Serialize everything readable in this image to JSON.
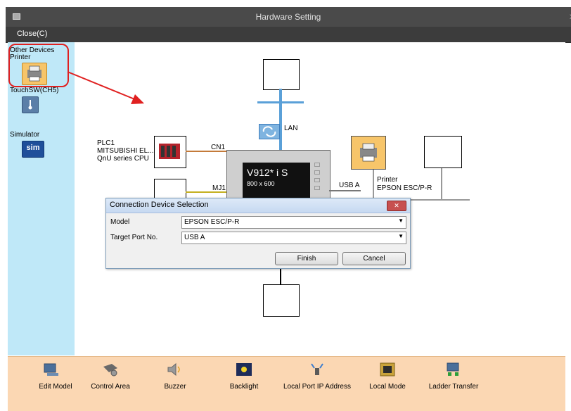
{
  "window": {
    "title": "Hardware Setting",
    "close_symbol": "x"
  },
  "menu": {
    "close_label": "Close(C)"
  },
  "sidebar": {
    "other_devices_label": "Other Devices",
    "printer_label": "Printer",
    "touchsw_label": "TouchSW(CH5)",
    "simulator_label": "Simulator",
    "sim_icon_text": "sim"
  },
  "diagram": {
    "lan_label": "LAN",
    "cn1_label": "CN1",
    "mj1_label": "MJ1",
    "usba_label": "USB A",
    "plc": {
      "line1": "PLC1",
      "line2": "MITSUBISHI EL...",
      "line3": "QnU series CPU"
    },
    "printer": {
      "line1": "Printer",
      "line2": "EPSON ESC/P-R"
    },
    "panel": {
      "model": "V912* i S",
      "resolution": "800 x 600"
    }
  },
  "dialog": {
    "title": "Connection Device Selection",
    "model_label": "Model",
    "model_value": "EPSON ESC/P-R",
    "port_label": "Target Port No.",
    "port_value": "USB A",
    "finish_label": "Finish",
    "cancel_label": "Cancel"
  },
  "toolbar": {
    "items": [
      {
        "label": "Edit Model",
        "icon": "edit-model-icon"
      },
      {
        "label": "Control Area",
        "icon": "control-area-icon"
      },
      {
        "label": "Buzzer",
        "icon": "buzzer-icon"
      },
      {
        "label": "Backlight",
        "icon": "backlight-icon"
      },
      {
        "label": "Local Port IP Address",
        "icon": "ip-address-icon"
      },
      {
        "label": "Local Mode",
        "icon": "local-mode-icon"
      },
      {
        "label": "Ladder Transfer",
        "icon": "ladder-transfer-icon"
      }
    ]
  },
  "colors": {
    "accent_red": "#e02020",
    "sidebar_bg": "#bfe8f8",
    "toolbar_bg": "#fbd7b3",
    "lan_blue": "#5aa0d8"
  }
}
